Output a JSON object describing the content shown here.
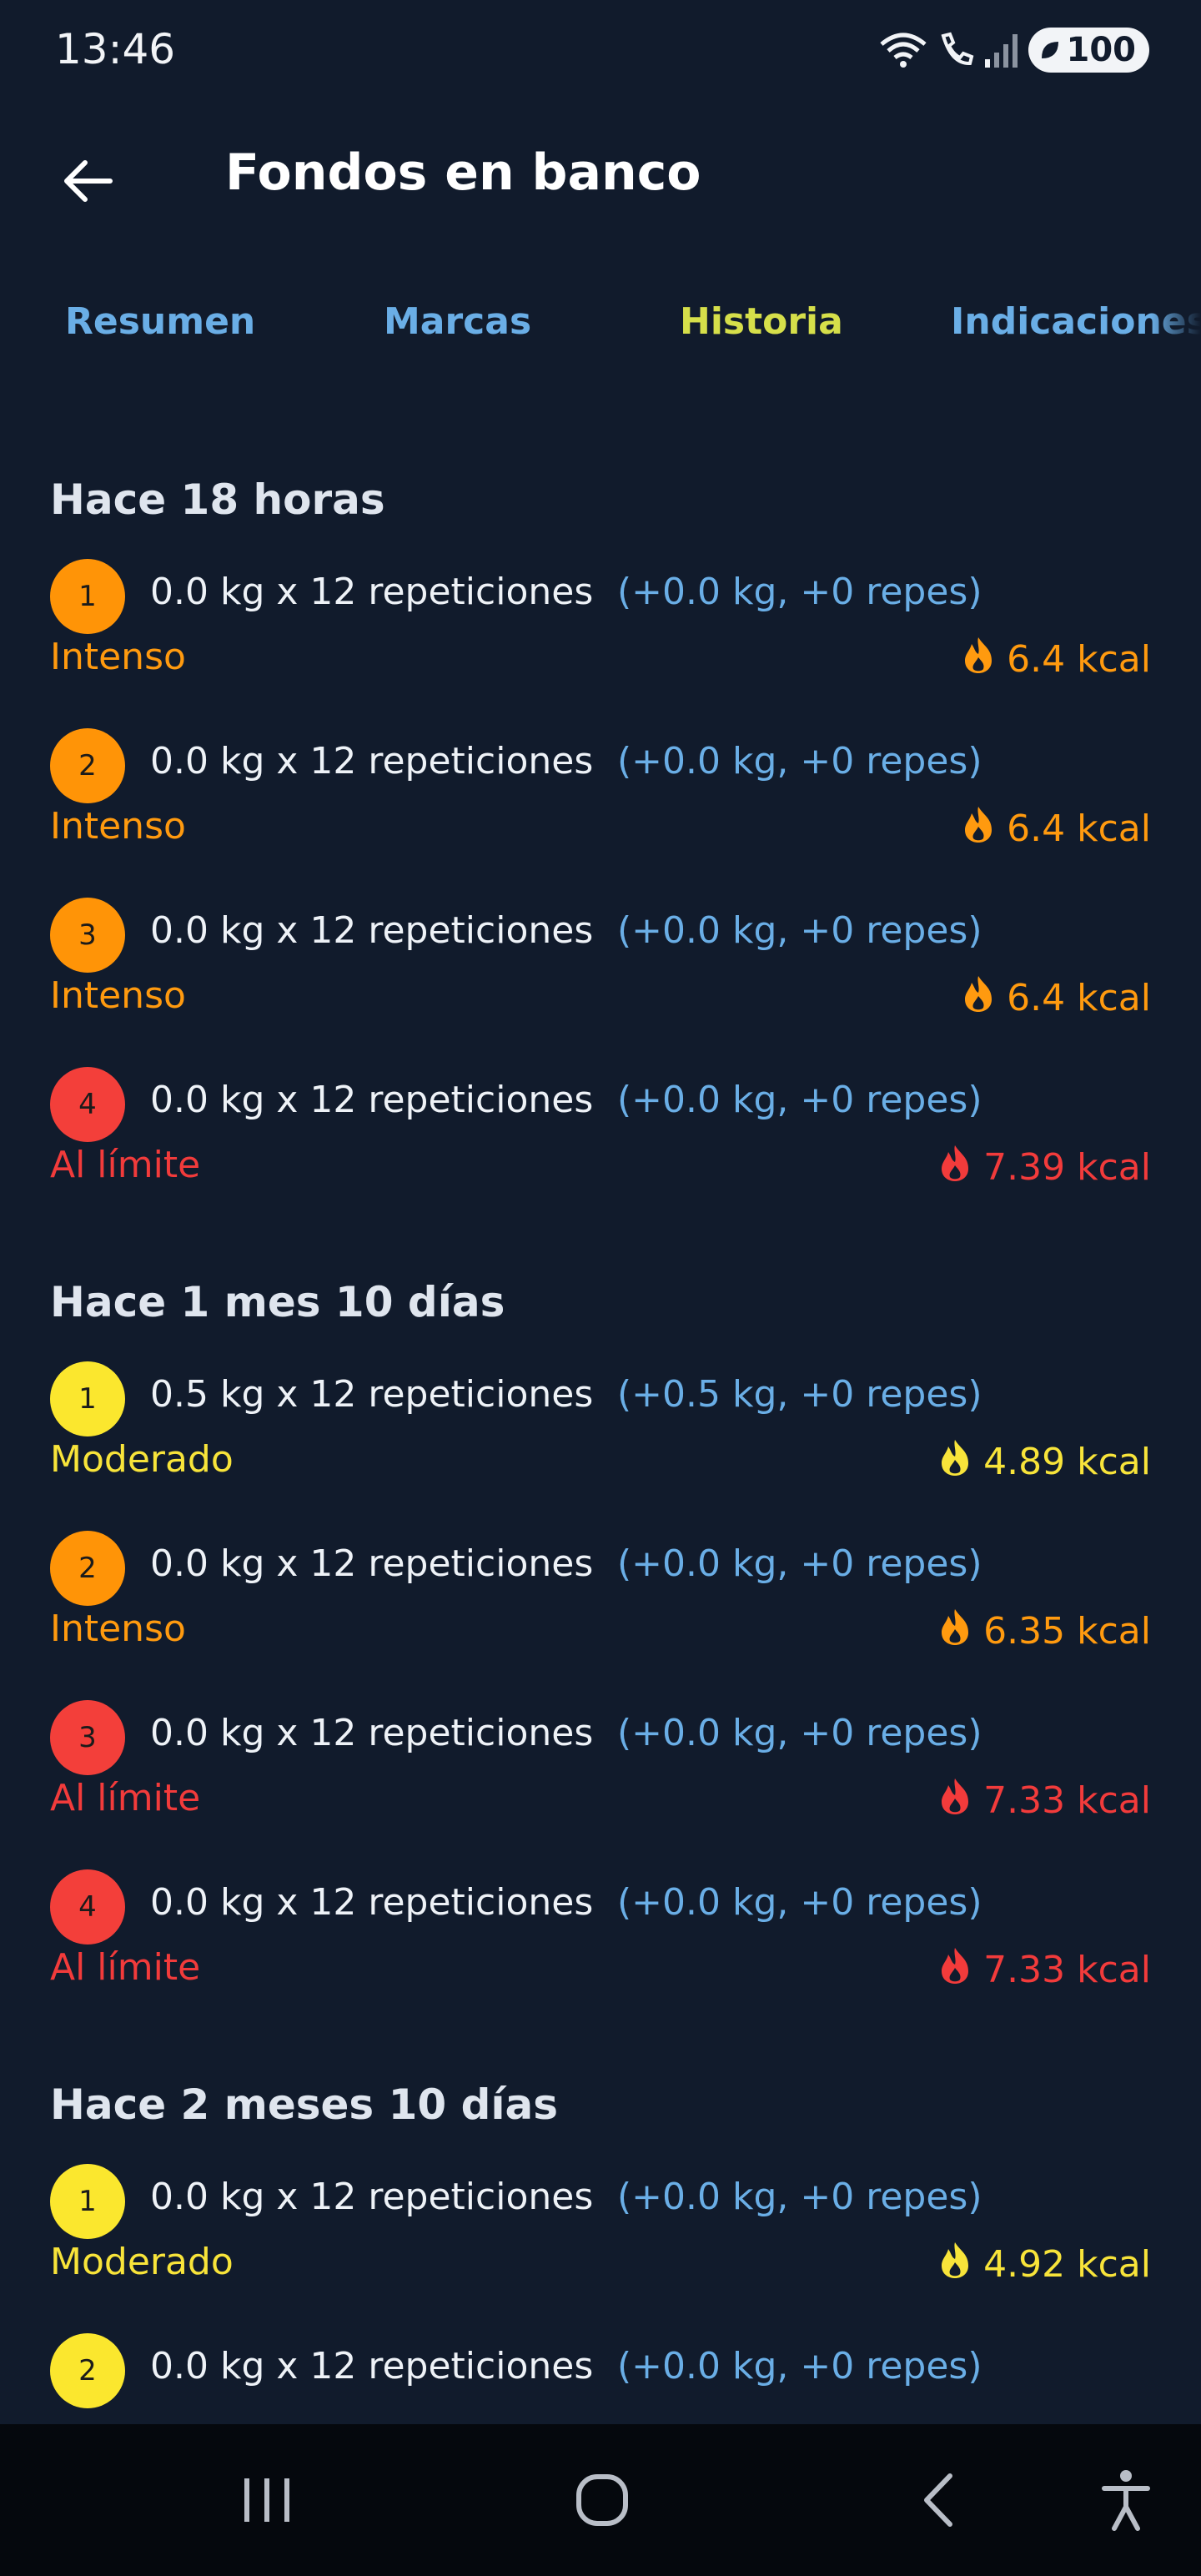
{
  "status": {
    "time": "13:46",
    "battery": "100",
    "icons": [
      "wifi-calling-icon",
      "call-icon",
      "signal-icon",
      "battery-icon"
    ]
  },
  "app_bar": {
    "title": "Fondos en banco"
  },
  "tabs": [
    {
      "label": "Resumen",
      "active": false
    },
    {
      "label": "Marcas",
      "active": false
    },
    {
      "label": "Historia",
      "active": true
    },
    {
      "label": "Indicaciones",
      "active": false
    }
  ],
  "colors": {
    "background": "#111b2c",
    "moderate": "#f8e43a",
    "intense": "#ff9a0f",
    "limit": "#f23b3b",
    "delta": "#6aaee6",
    "active_tab": "#d6df4a"
  },
  "history": [
    {
      "title": "Hace 18 horas",
      "sets": [
        {
          "num": "1",
          "text": "0.0 kg x 12 repeticiones",
          "delta": "(+0.0 kg, +0 repes)",
          "level": "orange",
          "intensity": "Intenso",
          "kcal": "6.4 kcal"
        },
        {
          "num": "2",
          "text": "0.0 kg x 12 repeticiones",
          "delta": "(+0.0 kg, +0 repes)",
          "level": "orange",
          "intensity": "Intenso",
          "kcal": "6.4 kcal"
        },
        {
          "num": "3",
          "text": "0.0 kg x 12 repeticiones",
          "delta": "(+0.0 kg, +0 repes)",
          "level": "orange",
          "intensity": "Intenso",
          "kcal": "6.4 kcal"
        },
        {
          "num": "4",
          "text": "0.0 kg x 12 repeticiones",
          "delta": "(+0.0 kg, +0 repes)",
          "level": "red",
          "intensity": "Al límite",
          "kcal": "7.39 kcal"
        }
      ]
    },
    {
      "title": "Hace 1 mes 10 días",
      "sets": [
        {
          "num": "1",
          "text": "0.5 kg x 12 repeticiones",
          "delta": "(+0.5 kg, +0 repes)",
          "level": "yellow",
          "intensity": "Moderado",
          "kcal": "4.89 kcal"
        },
        {
          "num": "2",
          "text": "0.0 kg x 12 repeticiones",
          "delta": "(+0.0 kg, +0 repes)",
          "level": "orange",
          "intensity": "Intenso",
          "kcal": "6.35 kcal"
        },
        {
          "num": "3",
          "text": "0.0 kg x 12 repeticiones",
          "delta": "(+0.0 kg, +0 repes)",
          "level": "red",
          "intensity": "Al límite",
          "kcal": "7.33 kcal"
        },
        {
          "num": "4",
          "text": "0.0 kg x 12 repeticiones",
          "delta": "(+0.0 kg, +0 repes)",
          "level": "red",
          "intensity": "Al límite",
          "kcal": "7.33 kcal"
        }
      ]
    },
    {
      "title": "Hace 2 meses 10 días",
      "sets": [
        {
          "num": "1",
          "text": "0.0 kg x 12 repeticiones",
          "delta": "(+0.0 kg, +0 repes)",
          "level": "yellow",
          "intensity": "Moderado",
          "kcal": "4.92 kcal"
        },
        {
          "num": "2",
          "text": "0.0 kg x 12 repeticiones",
          "delta": "(+0.0 kg, +0 repes)",
          "level": "yellow",
          "intensity": "",
          "kcal": ""
        }
      ]
    }
  ],
  "nav": [
    "recent-apps-icon",
    "home-icon",
    "back-icon",
    "accessibility-icon"
  ]
}
